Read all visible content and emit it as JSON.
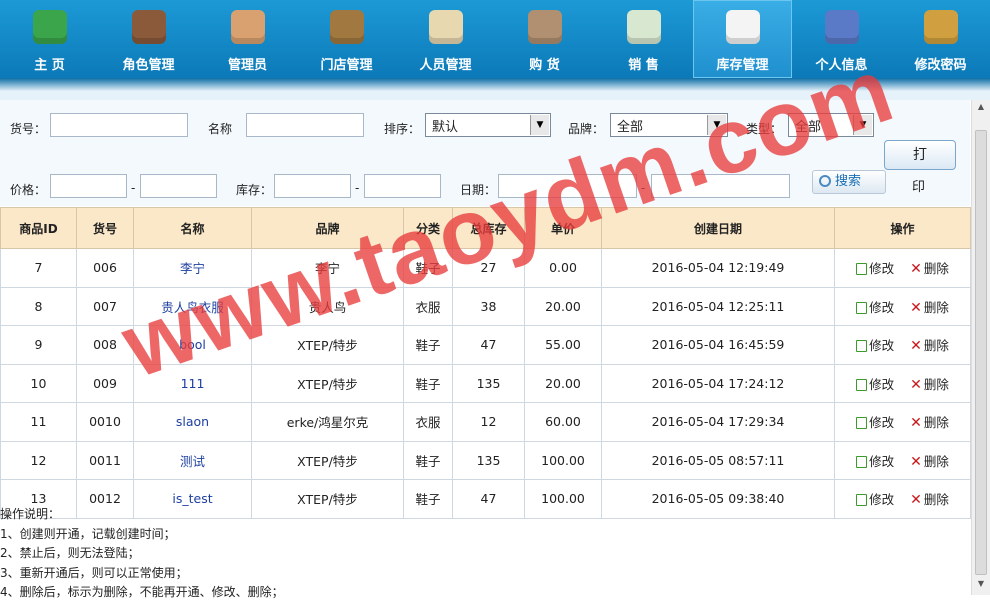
{
  "nav": {
    "items": [
      {
        "label": "主  页",
        "icon": "house-icon",
        "color": "#3aa54a"
      },
      {
        "label": "角色管理",
        "icon": "waiter-icon",
        "color": "#8a5a3a"
      },
      {
        "label": "管理员",
        "icon": "admin-icon",
        "color": "#d9a070"
      },
      {
        "label": "门店管理",
        "icon": "store-card-icon",
        "color": "#a07840"
      },
      {
        "label": "人员管理",
        "icon": "person-card-icon",
        "color": "#e8d8b0"
      },
      {
        "label": "购  货",
        "icon": "clipboard-icon",
        "color": "#b09070"
      },
      {
        "label": "销  售",
        "icon": "chart-doc-icon",
        "color": "#d8e8d0"
      },
      {
        "label": "库存管理",
        "icon": "document-icon",
        "color": "#f4f4f4",
        "active": true
      },
      {
        "label": "个人信息",
        "icon": "users-icon",
        "color": "#5a7ac8"
      },
      {
        "label": "修改密码",
        "icon": "user-lock-icon",
        "color": "#d0a040"
      }
    ]
  },
  "search": {
    "sku_label": "货号：",
    "name_label": "名称",
    "sort_label": "排序：",
    "sort_value": "默认",
    "brand_label": "品牌：",
    "brand_value": "全部",
    "type_label": "类型：",
    "type_value": "全部",
    "price_label": "价格：",
    "stock_label": "库存：",
    "date_label": "日期：",
    "dash": "-",
    "search_btn": "搜索",
    "print_btn": "打",
    "print_tail": "印"
  },
  "table": {
    "headers": [
      "商品ID",
      "货号",
      "名称",
      "品牌",
      "分类",
      "总库存",
      "单价",
      "创建日期",
      "操作"
    ],
    "edit_label": "修改",
    "delete_label": "删除",
    "rows": [
      {
        "id": "7",
        "sku": "006",
        "name": "李宁",
        "brand": "李宁",
        "category": "鞋子",
        "stock": "27",
        "price": "0.00",
        "date": "2016-05-04 12:19:49"
      },
      {
        "id": "8",
        "sku": "007",
        "name": "贵人鸟衣服",
        "brand": "贵人鸟",
        "category": "衣服",
        "stock": "38",
        "price": "20.00",
        "date": "2016-05-04 12:25:11"
      },
      {
        "id": "9",
        "sku": "008",
        "name": "bool",
        "brand": "XTEP/特步",
        "category": "鞋子",
        "stock": "47",
        "price": "55.00",
        "date": "2016-05-04 16:45:59"
      },
      {
        "id": "10",
        "sku": "009",
        "name": "111",
        "brand": "XTEP/特步",
        "category": "鞋子",
        "stock": "135",
        "price": "20.00",
        "date": "2016-05-04 17:24:12"
      },
      {
        "id": "11",
        "sku": "0010",
        "name": "slaon",
        "brand": "erke/鸿星尔克",
        "category": "衣服",
        "stock": "12",
        "price": "60.00",
        "date": "2016-05-04 17:29:34"
      },
      {
        "id": "12",
        "sku": "0011",
        "name": "测试",
        "brand": "XTEP/特步",
        "category": "鞋子",
        "stock": "135",
        "price": "100.00",
        "date": "2016-05-05 08:57:11"
      },
      {
        "id": "13",
        "sku": "0012",
        "name": "is_test",
        "brand": "XTEP/特步",
        "category": "鞋子",
        "stock": "47",
        "price": "100.00",
        "date": "2016-05-05 09:38:40"
      }
    ]
  },
  "notes": {
    "title": "操作说明：",
    "lines": [
      "1、创建则开通，记载创建时间；",
      "2、禁止后，则无法登陆；",
      "3、重新开通后，则可以正常使用；",
      "4、删除后，标示为删除，不能再开通、修改、删除；"
    ]
  },
  "watermark": "www.taoydm.com"
}
